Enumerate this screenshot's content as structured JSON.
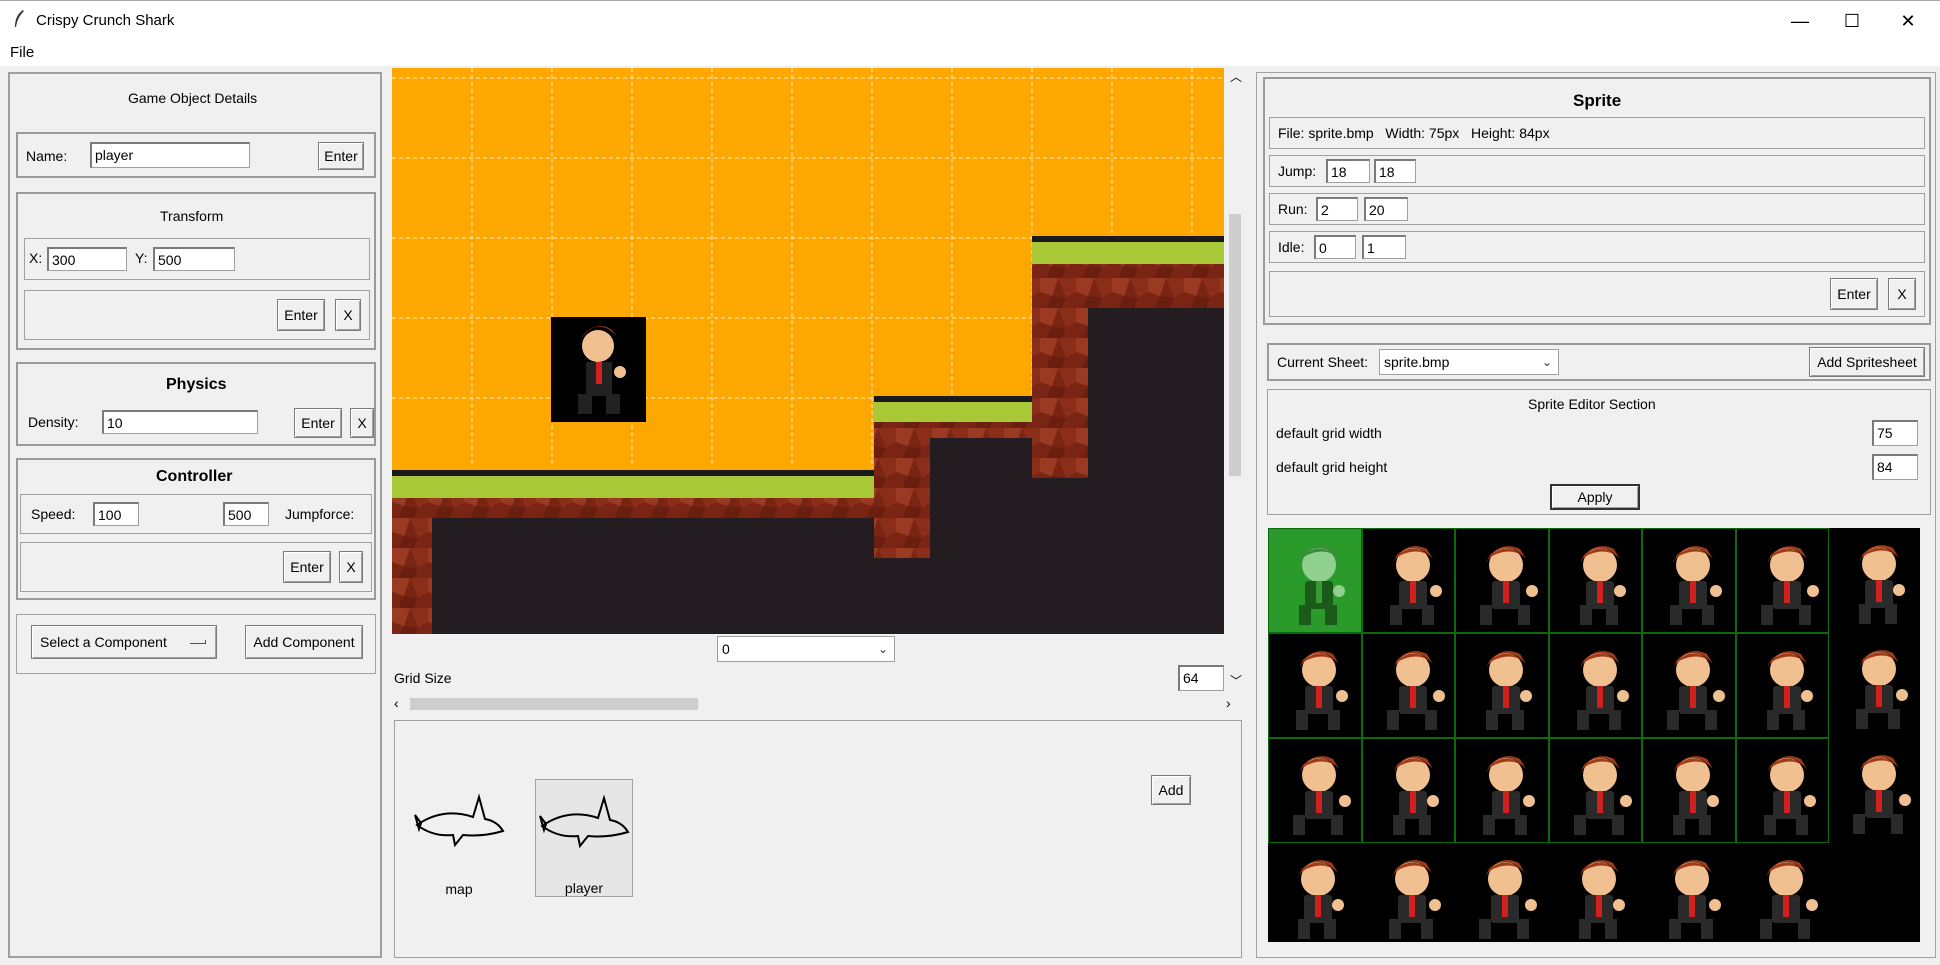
{
  "window": {
    "title": "Crispy Crunch Shark",
    "minimize": "—",
    "maximize": "☐",
    "close": "✕"
  },
  "menu": {
    "file": "File"
  },
  "left": {
    "header": "Game Object Details",
    "name_label": "Name:",
    "name_value": "player",
    "enter": "Enter",
    "transform": {
      "title": "Transform",
      "x_label": "X:",
      "x_value": "300",
      "y_label": "Y:",
      "y_value": "500",
      "enter": "Enter",
      "remove": "X"
    },
    "physics": {
      "title": "Physics",
      "density_label": "Density:",
      "density_value": "10",
      "enter": "Enter",
      "remove": "X"
    },
    "controller": {
      "title": "Controller",
      "speed_label": "Speed:",
      "speed_value": "100",
      "jump_value": "500",
      "jumpforce_label": "Jumpforce:",
      "enter": "Enter",
      "remove": "X"
    },
    "select_component": "Select a Component",
    "add_component": "Add Component"
  },
  "center": {
    "layer_select": "0",
    "grid_size_label": "Grid Size",
    "grid_size_value": "64",
    "add": "Add",
    "assets": [
      {
        "label": "map",
        "icon": "shark-icon"
      },
      {
        "label": "player",
        "icon": "shark-icon"
      }
    ]
  },
  "right": {
    "sprite": {
      "title": "Sprite",
      "file_info": "File: sprite.bmp   Width: 75px   Height: 84px",
      "jump_label": "Jump:",
      "jump_a": "18",
      "jump_b": "18",
      "run_label": "Run:",
      "run_a": "2",
      "run_b": "20",
      "idle_label": "Idle:",
      "idle_a": "0",
      "idle_b": "1",
      "enter": "Enter",
      "remove": "X"
    },
    "current_sheet_label": "Current Sheet:",
    "current_sheet_value": "sprite.bmp",
    "add_spritesheet": "Add Spritesheet",
    "editor": {
      "title": "Sprite Editor Section",
      "grid_width_label": "default grid width",
      "grid_width_value": "75",
      "grid_height_label": "default grid height",
      "grid_height_value": "84",
      "apply": "Apply"
    },
    "frame_count": 27,
    "selected_frame": 0
  },
  "colors": {
    "sky": "#fca800",
    "grass": "#a8c838",
    "rock": "#8a2a18",
    "cave": "#221c22",
    "select_green": "#2a9a2a"
  }
}
